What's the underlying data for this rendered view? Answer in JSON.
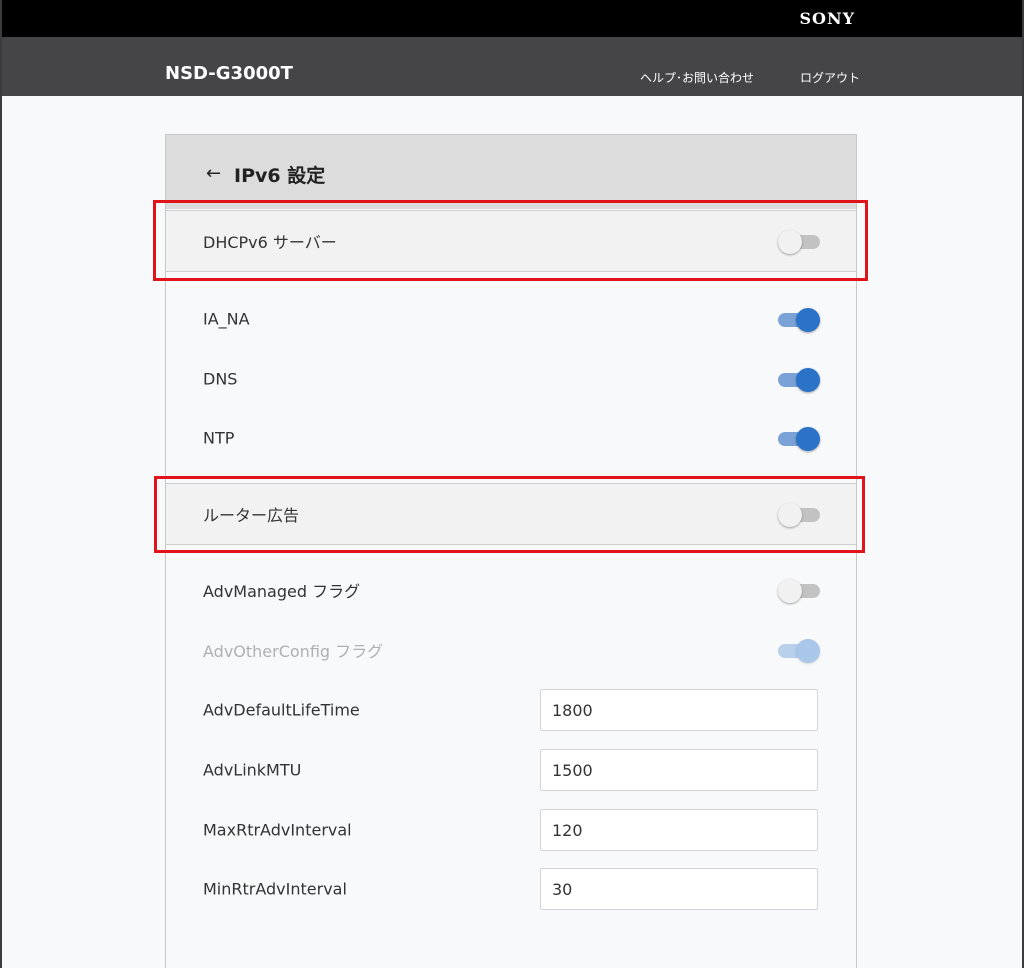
{
  "brand": "SONY",
  "header": {
    "product": "NSD-G3000T",
    "help_link": "ヘルプ･お問い合わせ",
    "logout_link": "ログアウト"
  },
  "panel": {
    "back_icon": "←",
    "title": "IPv6 設定"
  },
  "rows": {
    "dhcpv6_server": {
      "label": "DHCPv6 サーバー",
      "on": false
    },
    "ia_na": {
      "label": "IA_NA",
      "on": true
    },
    "dns": {
      "label": "DNS",
      "on": true
    },
    "ntp": {
      "label": "NTP",
      "on": true
    },
    "router_adv": {
      "label": "ルーター広告",
      "on": false
    },
    "adv_managed": {
      "label": "AdvManaged フラグ",
      "on": false
    },
    "adv_other_config": {
      "label": "AdvOtherConfig フラグ",
      "on": true,
      "disabled": true
    },
    "adv_default_lifetime": {
      "label": "AdvDefaultLifeTime",
      "value": "1800"
    },
    "adv_link_mtu": {
      "label": "AdvLinkMTU",
      "value": "1500"
    },
    "max_rtr_adv_interval": {
      "label": "MaxRtrAdvInterval",
      "value": "120"
    },
    "min_rtr_adv_interval": {
      "label": "MinRtrAdvInterval",
      "value": "30"
    }
  },
  "colors": {
    "highlight": "#e0151c",
    "toggle_on": "#2a73c8",
    "header_bg": "#454547"
  },
  "icons": {
    "back": "arrow-left-icon"
  }
}
